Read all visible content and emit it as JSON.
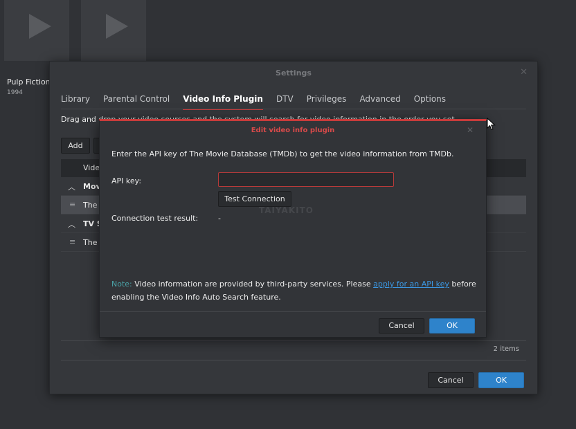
{
  "library": {
    "items": [
      {
        "title": "Pulp Fiction",
        "year": "1994"
      },
      {
        "title": "",
        "year": ""
      }
    ]
  },
  "settings": {
    "title": "Settings",
    "tabs": [
      {
        "label": "Library"
      },
      {
        "label": "Parental Control"
      },
      {
        "label": "Video Info Plugin",
        "active": true
      },
      {
        "label": "DTV"
      },
      {
        "label": "Privileges"
      },
      {
        "label": "Advanced"
      },
      {
        "label": "Options"
      }
    ],
    "description": "Drag and drop your video sources and the system will search for video information in the order you set.",
    "add_label": "Add",
    "table": {
      "header": "Video",
      "rows": [
        {
          "type": "group",
          "label": "Movie"
        },
        {
          "type": "item",
          "label": "The I",
          "selected": true
        },
        {
          "type": "group",
          "label": "TV S"
        },
        {
          "type": "item",
          "label": "The I",
          "selected": false
        }
      ]
    },
    "items_count": "2 items",
    "cancel_label": "Cancel",
    "ok_label": "OK"
  },
  "dialog": {
    "title": "Edit video info plugin",
    "intro": "Enter the API key of The Movie Database (TMDb) to get the video information from TMDb.",
    "api_key_label": "API key:",
    "api_key_value": "",
    "test_button": "Test Connection",
    "test_result_label": "Connection test result:",
    "test_result_value": "-",
    "note_prefix": "Note:",
    "note_text_1": " Video information are provided by third-party services. Please ",
    "note_link": "apply for an API key",
    "note_text_2": " before enabling the Video Info Auto Search feature.",
    "cancel_label": "Cancel",
    "ok_label": "OK",
    "watermark": "TAIYAKITO"
  },
  "colors": {
    "accent_red": "#c83b3b",
    "primary_blue": "#2e83cb",
    "link_blue": "#3b96e0",
    "note_teal": "#4aa3a8"
  }
}
